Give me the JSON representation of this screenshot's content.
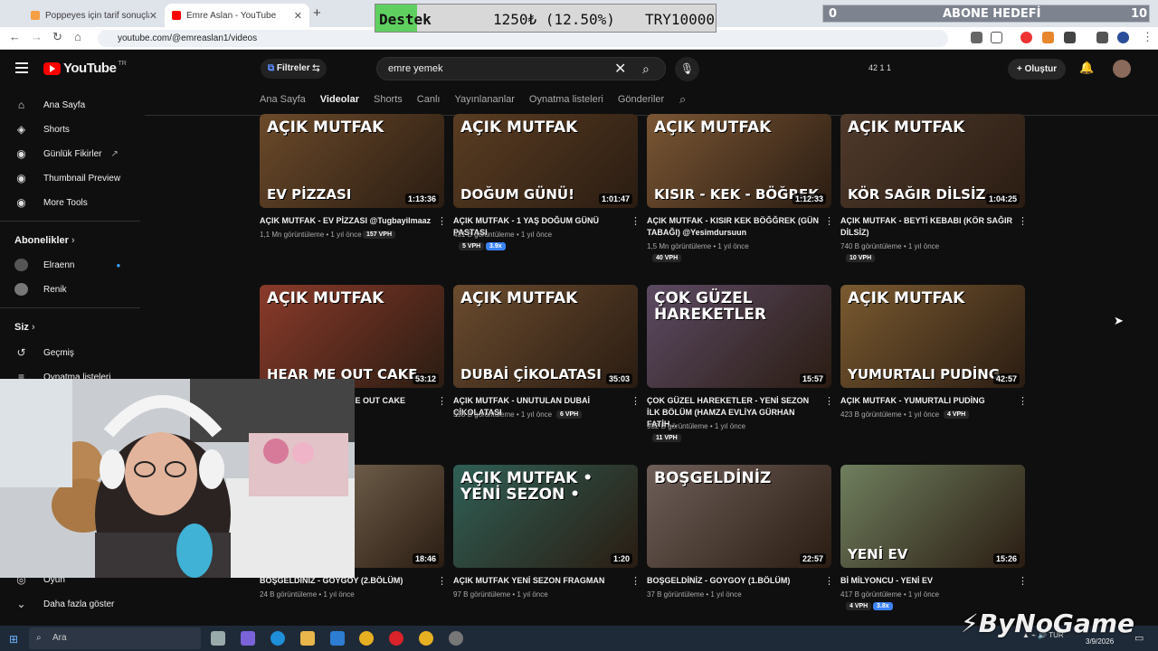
{
  "browser": {
    "tabs": [
      {
        "title": "Poppeyes için tarif sonuçları - N",
        "favicon_color": "#f59e42"
      },
      {
        "title": "Emre Aslan - YouTube",
        "favicon_color": "#ff0000"
      }
    ],
    "new_tab_icon": "plus-icon",
    "url": "youtube.com/@emreaslan1/videos"
  },
  "overlay": {
    "donation_label": "Destek",
    "donation_amount": "1250₺ (12.50%)",
    "donation_goal": "TRY10000",
    "donation_progress": 0.125,
    "subgoal_current": "0",
    "subgoal_label": "ABONE HEDEFİ",
    "subgoal_target": "10"
  },
  "yt": {
    "logo": "YouTube",
    "logo_region": "TR",
    "filters_label": "Filtreler",
    "search_value": "emre yemek",
    "stats": "42  1  1",
    "create_label": "Oluştur",
    "channel_tabs": [
      "Ana Sayfa",
      "Videolar",
      "Shorts",
      "Canlı",
      "Yayınlananlar",
      "Oynatma listeleri",
      "Gönderiler"
    ],
    "active_tab": "Videolar"
  },
  "sidebar": {
    "main": [
      {
        "label": "Ana Sayfa",
        "icon": "home-icon"
      },
      {
        "label": "Shorts",
        "icon": "shorts-icon"
      },
      {
        "label": "Günlük Fikirler",
        "icon": "extension-icon"
      },
      {
        "label": "Thumbnail Preview",
        "icon": "extension-icon"
      },
      {
        "label": "More Tools",
        "icon": "extension-icon"
      }
    ],
    "subs_heading": "Abonelikler",
    "subs": [
      {
        "label": "Elraenn"
      },
      {
        "label": "Renik"
      }
    ],
    "you_heading": "Siz",
    "you": [
      {
        "label": "Geçmiş",
        "icon": "history-icon"
      },
      {
        "label": "Oynatma listeleri",
        "icon": "playlist-icon"
      }
    ],
    "bottom": [
      {
        "label": "Oyun",
        "icon": "game-icon"
      },
      {
        "label": "Daha fazla göster",
        "icon": "chevron-down-icon"
      }
    ]
  },
  "videos": [
    {
      "title": "AÇIK MUTFAK - EV PİZZASI @Tugbayilmaaz",
      "meta": "1,1 Mn görüntüleme • 1 yıl önce",
      "duration": "1:13:36",
      "vph": "157 VPH",
      "overlay": "AÇIK MUTFAK",
      "caption": "EV PİZZASI",
      "color": "#6b4a2a"
    },
    {
      "title": "AÇIK MUTFAK - 1 YAŞ DOĞUM GÜNÜ PASTASI",
      "meta": "431 B görüntüleme • 1 yıl önce",
      "duration": "1:01:47",
      "vph": "5 VPH",
      "mult": "3.9x",
      "overlay": "AÇIK MUTFAK",
      "caption": "DOĞUM GÜNÜ!",
      "color": "#5a3d22"
    },
    {
      "title": "AÇIK MUTFAK - KISIR KEK BÖĞĞREK (GÜN TABAĞI) @Yesimdursuun",
      "meta": "1,5 Mn görüntüleme • 1 yıl önce",
      "duration": "1:12:33",
      "vph": "40 VPH",
      "overlay": "AÇIK MUTFAK",
      "caption": "KISIR - KEK - BÖĞREK",
      "color": "#7a5634"
    },
    {
      "title": "AÇIK MUTFAK - BEYTİ KEBABI (KÖR SAĞIR DİLSİZ)",
      "meta": "740 B görüntüleme • 1 yıl önce",
      "duration": "1:04:25",
      "vph": "10 VPH",
      "overlay": "AÇIK MUTFAK",
      "caption": "KÖR SAĞIR DİLSİZ",
      "color": "#4f3a2c"
    },
    {
      "title": "AÇIK MUTFAK - HEAR ME OUT CAKE @Yesimdursuun",
      "meta": "",
      "duration": "53:12",
      "vph": "8 VPH",
      "overlay": "AÇIK MUTFAK",
      "caption": "HEAR ME OUT CAKE",
      "color": "#8a3a2a"
    },
    {
      "title": "AÇIK MUTFAK - UNUTULAN DUBAİ ÇİKOLATASI",
      "meta": "598 B görüntüleme • 1 yıl önce",
      "duration": "35:03",
      "vph": "6 VPH",
      "overlay": "AÇIK MUTFAK",
      "caption": "DUBAİ ÇİKOLATASI",
      "color": "#6a4b2e"
    },
    {
      "title": "ÇOK GÜZEL HAREKETLER - YENİ SEZON İLK BÖLÜM (HAMZA EVLİYA GÜRHAN FATİH...",
      "meta": "932 B görüntüleme • 1 yıl önce",
      "duration": "15:57",
      "vph": "11 VPH",
      "overlay": "ÇOK GÜZEL HAREKETLER",
      "caption": "",
      "color": "#5c4a63"
    },
    {
      "title": "AÇIK MUTFAK - YUMURTALI PUDİNG",
      "meta": "423 B görüntüleme • 1 yıl önce",
      "duration": "42:57",
      "vph": "4 VPH",
      "overlay": "AÇIK MUTFAK",
      "caption": "YUMURTALI PUDİNG",
      "color": "#7a5a30"
    },
    {
      "title": "BOŞGELDİNİZ - GOYGOY (2.BÖLÜM)",
      "meta": "24 B görüntüleme • 1 yıl önce",
      "duration": "18:46",
      "vph": "",
      "overlay": "",
      "caption": "",
      "color": "#8c7a62"
    },
    {
      "title": "AÇIK MUTFAK YENİ SEZON FRAGMAN",
      "meta": "97 B görüntüleme • 1 yıl önce",
      "duration": "1:20",
      "vph": "",
      "overlay": "AÇIK MUTFAK • YENİ SEZON •",
      "caption": "",
      "color": "#2f5f55"
    },
    {
      "title": "BOŞGELDİNİZ - GOYGOY (1.BÖLÜM)",
      "meta": "37 B görüntüleme • 1 yıl önce",
      "duration": "22:57",
      "vph": "",
      "overlay": "BOŞGELDİNİZ",
      "caption": "",
      "color": "#6e5e58"
    },
    {
      "title": "Bİ MİLYONCU - YENİ EV",
      "meta": "417 B görüntüleme • 1 yıl önce",
      "duration": "15:26",
      "vph": "4 VPH",
      "mult": "3.8x",
      "overlay": "",
      "caption": "YENİ EV",
      "color": "#6f7f5e"
    }
  ],
  "taskbar": {
    "search_placeholder": "Ara",
    "tray_lang": "TUR",
    "date": "3/9/2026"
  },
  "watermark": "ByNoGame"
}
